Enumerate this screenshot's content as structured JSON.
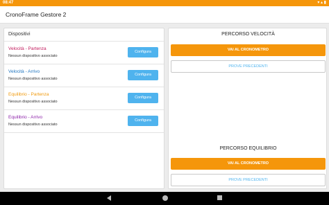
{
  "status_bar": {
    "time": "08:47",
    "indicators": "▾ ▴ ▮"
  },
  "app": {
    "title": "CronoFrame Gestore 2"
  },
  "devices": {
    "header": "Dispositivi",
    "items": [
      {
        "name": "Velocità - Partenza",
        "status": "Nessun dispositivo associato",
        "button": "Configura",
        "color": "#c2185b"
      },
      {
        "name": "Velocità - Arrivo",
        "status": "Nessun dispositivo associato",
        "button": "Configura",
        "color": "#1e73be"
      },
      {
        "name": "Equilibrio - Partenza",
        "status": "Nessun dispositivo associato",
        "button": "Configura",
        "color": "#f09a0e"
      },
      {
        "name": "Equilibrio - Arrivo",
        "status": "Nessun dispositivo associato",
        "button": "Configura",
        "color": "#8e24aa"
      }
    ]
  },
  "speed": {
    "title": "PERCORSO VELOCITÀ",
    "start_button": "VAI AL CRONOMETRO",
    "tests_button": "PROVE PRECEDENTI"
  },
  "balance": {
    "title": "PERCORSO EQUILIBRIO",
    "start_button": "VAI AL CRONOMETRO",
    "tests_button": "PROVE PRECEDENTI"
  },
  "colors": {
    "accent": "#f5960b",
    "button_blue": "#4fb3ee"
  }
}
